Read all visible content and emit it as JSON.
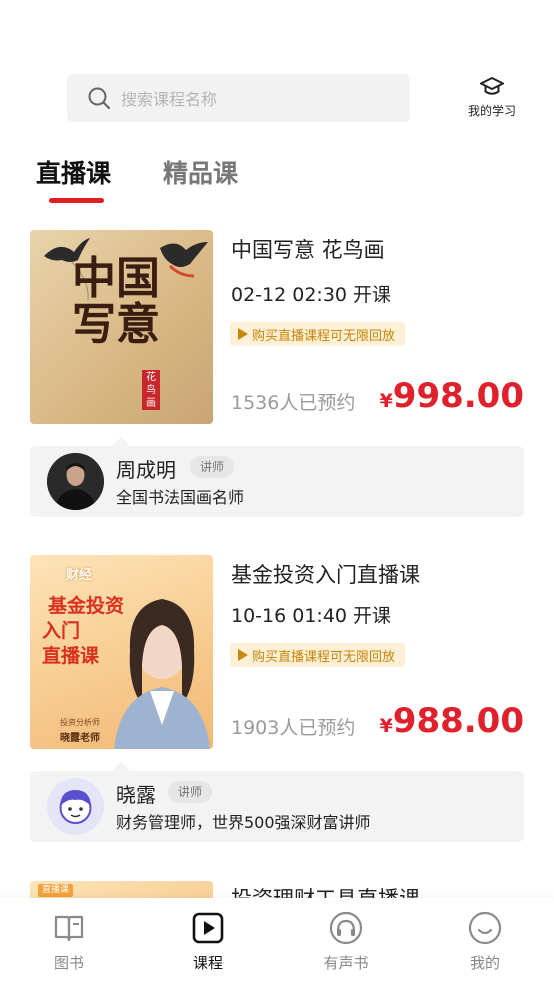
{
  "search": {
    "placeholder": "搜索课程名称"
  },
  "header": {
    "my_study_label": "我的学习"
  },
  "tabs": [
    {
      "label": "直播课",
      "active": true
    },
    {
      "label": "精品课",
      "active": false
    }
  ],
  "courses": [
    {
      "title": "中国写意 花鸟画",
      "start_time": "02-12 02:30 开课",
      "badge": "购买直播课程可无限回放",
      "booked": "1536人已预约",
      "currency": "¥",
      "price": "998.00",
      "thumb_text": "中国写意",
      "thumb_seal": "花鸟画",
      "teacher": {
        "name": "周成明",
        "role": "讲师",
        "desc": "全国书法国画名师"
      }
    },
    {
      "title": "基金投资入门直播课",
      "start_time": "10-16 01:40 开课",
      "badge": "购买直播课程可无限回放",
      "booked": "1903人已预约",
      "currency": "¥",
      "price": "988.00",
      "thumb_tag": "财经",
      "thumb_title_1": "基金投资",
      "thumb_title_2": "入门",
      "thumb_title_3": "直播课",
      "thumb_sub": "投资分析师",
      "thumb_teacher": "晓露老师",
      "teacher": {
        "name": "晓露",
        "role": "讲师",
        "desc": "财务管理师，世界500强深财富讲师"
      }
    },
    {
      "title": "投资理财工具直播课",
      "thumb_tag": "直播课"
    }
  ],
  "bottom_nav": [
    {
      "label": "图书",
      "icon": "book-icon",
      "active": false
    },
    {
      "label": "课程",
      "icon": "play-icon",
      "active": true
    },
    {
      "label": "有声书",
      "icon": "headphones-icon",
      "active": false
    },
    {
      "label": "我的",
      "icon": "smile-icon",
      "active": false
    }
  ],
  "colors": {
    "accent": "#e02020",
    "price": "#e0202a",
    "badge_text": "#c8860a",
    "badge_bg": "#fdf0d6"
  }
}
